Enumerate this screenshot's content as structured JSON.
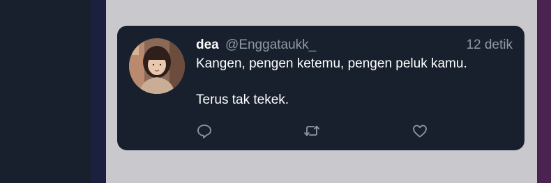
{
  "colors": {
    "card_background": "#17202c",
    "panel_background": "#c9c8cd",
    "name_text": "#ffffff",
    "secondary_text": "#8d99a6",
    "icon_stroke": "#8d99a6",
    "right_accent": "#4a2350"
  },
  "tweet": {
    "name": "dea",
    "handle": "@Enggataukk_",
    "time": "12 detik",
    "text": "Kangen, pengen ketemu, pengen peluk kamu.\n\nTerus tak tekek.",
    "avatar_icon": "user-avatar-photo"
  },
  "actions": {
    "reply_icon": "reply-icon",
    "retweet_icon": "retweet-icon",
    "like_icon": "heart-icon"
  }
}
